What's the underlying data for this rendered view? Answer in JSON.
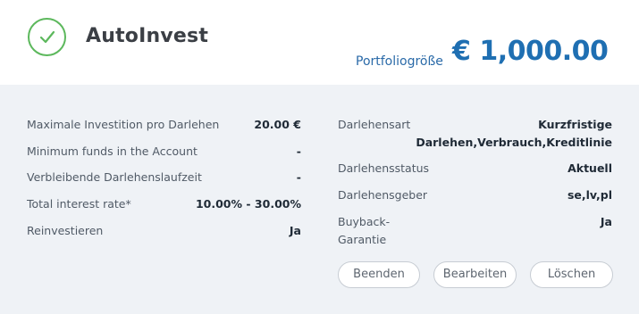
{
  "header": {
    "title": "AutoInvest",
    "status_icon": "check-circle-icon",
    "portfolio_label": "Portfoliogröße",
    "portfolio_value": "€ 1,000.00"
  },
  "left_details": [
    {
      "label": "Maximale Investition pro Darlehen",
      "value": "20.00 €"
    },
    {
      "label": "Minimum funds in the Account",
      "value": "-"
    },
    {
      "label": "Verbleibende Darlehenslaufzeit",
      "value": "-"
    },
    {
      "label": "Total interest rate*",
      "value": "10.00% - 30.00%"
    },
    {
      "label": "Reinvestieren",
      "value": "Ja"
    }
  ],
  "right_details": [
    {
      "label": "Darlehensart",
      "value_line1": "Kurzfristige",
      "value_line2": "Darlehen,Verbrauch,Kreditlinie"
    },
    {
      "label": "Darlehensstatus",
      "value": "Aktuell"
    },
    {
      "label": "Darlehensgeber",
      "value": "se,lv,pl"
    },
    {
      "label_line1": "Buyback-",
      "label_line2": "Garantie",
      "value": "Ja"
    }
  ],
  "buttons": {
    "stop": "Beenden",
    "edit": "Bearbeiten",
    "delete": "Löschen"
  },
  "colors": {
    "accent_blue": "#1f6fb2",
    "check_green": "#5cb85c",
    "panel_bg": "#eff2f6"
  }
}
